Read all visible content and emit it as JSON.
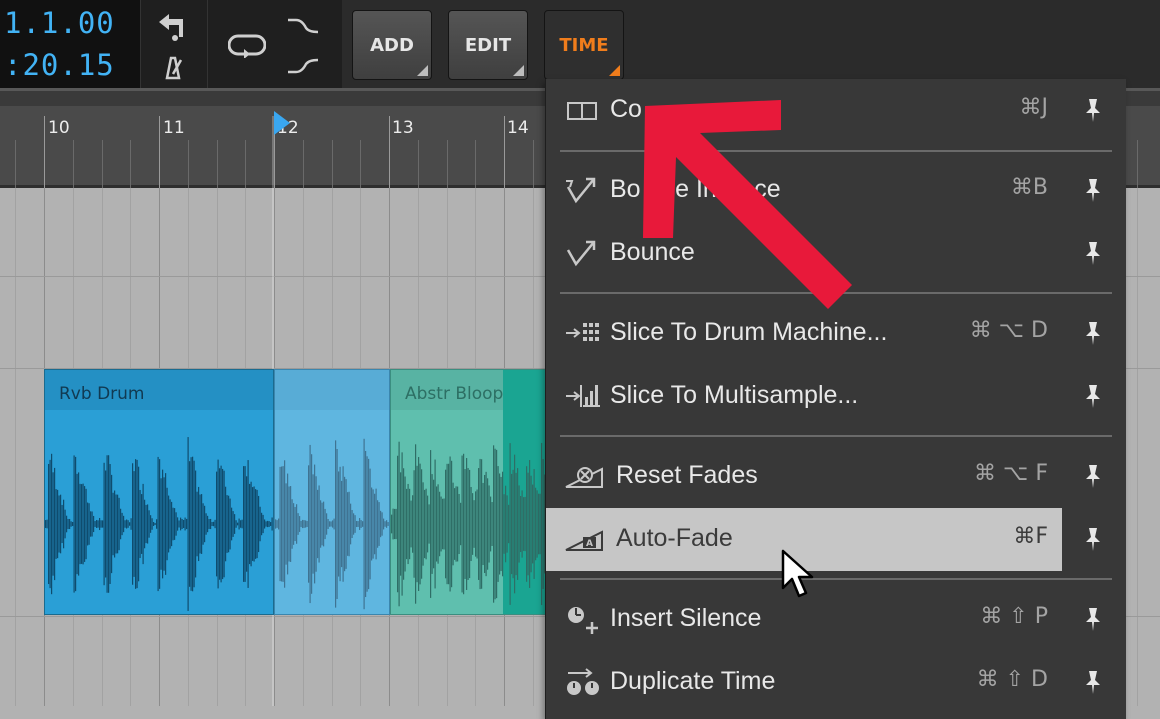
{
  "transport": {
    "position": "1.1.00",
    "time": ":20.15"
  },
  "toolbar": {
    "buttons": [
      {
        "label": "ADD"
      },
      {
        "label": "EDIT"
      },
      {
        "label": "TIME",
        "active": true
      }
    ]
  },
  "ruler": {
    "bars": [
      "10",
      "11",
      "12",
      "13",
      "14"
    ],
    "playhead_bar": 12
  },
  "clips": [
    {
      "name": "Rvb Drum",
      "color": "#2a9fd6"
    },
    {
      "name": "Abstr Bloops",
      "color": "#5fbfae"
    }
  ],
  "menu": {
    "groups": [
      [
        {
          "icon": "consolidate-icon",
          "label": "Co",
          "shortcut": "⌘J"
        }
      ],
      [
        {
          "icon": "bounce-in-place-icon",
          "label": "Bo",
          "label2": "ce In",
          "label3": "lace",
          "shortcut": "⌘B"
        },
        {
          "icon": "bounce-icon",
          "label": "Bounce",
          "shortcut": ""
        }
      ],
      [
        {
          "icon": "slice-drum-machine-icon",
          "label": "Slice To Drum Machine...",
          "shortcut": "⌘ ⌥ D"
        },
        {
          "icon": "slice-multisample-icon",
          "label": "Slice To Multisample...",
          "shortcut": ""
        }
      ],
      [
        {
          "icon": "reset-fades-icon",
          "label": "Reset Fades",
          "shortcut": "⌘ ⌥ F"
        },
        {
          "icon": "auto-fade-icon",
          "label": "Auto-Fade",
          "shortcut": "⌘F",
          "highlighted": true
        }
      ],
      [
        {
          "icon": "insert-silence-icon",
          "label": "Insert Silence",
          "shortcut": "⌘ ⇧ P"
        },
        {
          "icon": "duplicate-time-icon",
          "label": "Duplicate Time",
          "shortcut": "⌘ ⇧ D"
        }
      ]
    ]
  },
  "colors": {
    "accent_time": "#f07d1c",
    "counter_text": "#42b3f5",
    "annotation_arrow": "#e8193a"
  }
}
